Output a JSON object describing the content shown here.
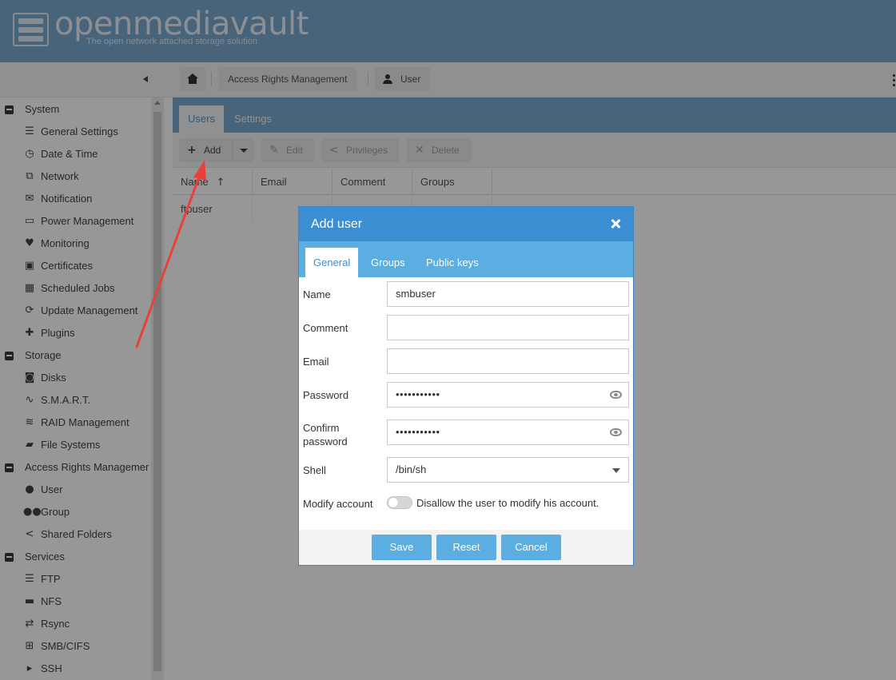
{
  "app": {
    "brand": "openmediavault",
    "tagline": "The open network attached storage solution"
  },
  "breadcrumb": {
    "home_icon": "home-icon",
    "items": [
      "Access Rights Management",
      "User"
    ]
  },
  "sidebar": {
    "groups": [
      {
        "label": "System",
        "items": [
          {
            "label": "General Settings",
            "icon": "sliders-icon"
          },
          {
            "label": "Date & Time",
            "icon": "clock-icon"
          },
          {
            "label": "Network",
            "icon": "network-icon"
          },
          {
            "label": "Notification",
            "icon": "envelope-icon"
          },
          {
            "label": "Power Management",
            "icon": "battery-icon"
          },
          {
            "label": "Monitoring",
            "icon": "heartbeat-icon"
          },
          {
            "label": "Certificates",
            "icon": "certificate-icon"
          },
          {
            "label": "Scheduled Jobs",
            "icon": "calendar-clock-icon"
          },
          {
            "label": "Update Management",
            "icon": "refresh-icon"
          },
          {
            "label": "Plugins",
            "icon": "puzzle-icon"
          }
        ]
      },
      {
        "label": "Storage",
        "items": [
          {
            "label": "Disks",
            "icon": "disk-icon"
          },
          {
            "label": "S.M.A.R.T.",
            "icon": "pulse-icon"
          },
          {
            "label": "RAID Management",
            "icon": "database-icon"
          },
          {
            "label": "File Systems",
            "icon": "folders-icon"
          }
        ]
      },
      {
        "label": "Access Rights Managemer",
        "items": [
          {
            "label": "User",
            "icon": "user-icon"
          },
          {
            "label": "Group",
            "icon": "users-icon"
          },
          {
            "label": "Shared Folders",
            "icon": "share-icon"
          }
        ]
      },
      {
        "label": "Services",
        "items": [
          {
            "label": "FTP",
            "icon": "server-icon"
          },
          {
            "label": "NFS",
            "icon": "desktop-icon"
          },
          {
            "label": "Rsync",
            "icon": "sync-icon"
          },
          {
            "label": "SMB/CIFS",
            "icon": "windows-icon"
          },
          {
            "label": "SSH",
            "icon": "terminal-icon"
          }
        ]
      }
    ]
  },
  "page_tabs": [
    "Users",
    "Settings"
  ],
  "toolbar": {
    "add": "Add",
    "edit": "Edit",
    "privileges": "Privileges",
    "delete": "Delete"
  },
  "table": {
    "columns": [
      "Name",
      "Email",
      "Comment",
      "Groups"
    ],
    "rows": [
      [
        "ftpuser",
        "",
        "",
        ""
      ]
    ]
  },
  "dialog": {
    "title": "Add user",
    "tabs": [
      "General",
      "Groups",
      "Public keys"
    ],
    "fields": {
      "name_label": "Name",
      "name_value": "smbuser",
      "comment_label": "Comment",
      "comment_value": "",
      "email_label": "Email",
      "email_value": "",
      "password_label": "Password",
      "password_value": "•••••••••••",
      "confirm_label_1": "Confirm",
      "confirm_label_2": "password",
      "confirm_value": "•••••••••••",
      "shell_label": "Shell",
      "shell_value": "/bin/sh",
      "modify_label": "Modify account",
      "modify_text": "Disallow the user to modify his account.",
      "modify_checked": false
    },
    "buttons": {
      "save": "Save",
      "reset": "Reset",
      "cancel": "Cancel"
    }
  },
  "colors": {
    "header": "#6fa3cc",
    "dialog_header": "#3b8ed2",
    "accent": "#5aaee2",
    "annotation_arrow": "#e8413c"
  }
}
